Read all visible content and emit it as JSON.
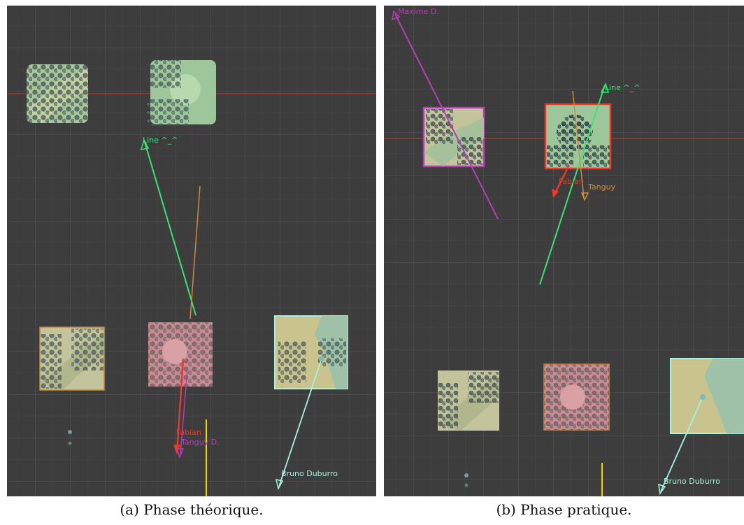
{
  "panel_a": {
    "caption": "(a) Phase théorique.",
    "labels": {
      "line": "Line ^_^",
      "fabian": "Fabian",
      "tanguy": "Tanguy D.",
      "bruno": "Bruno Duburro"
    }
  },
  "panel_b": {
    "caption": "(b) Phase pratique.",
    "labels": {
      "top_left": "Maxime D.",
      "line": "Line ^_^",
      "fabian": "Fabian",
      "tanguy": "Tanguy",
      "bruno": "Bruno Duburro"
    }
  },
  "colors": {
    "background": "#3d3d3d",
    "grid": "#575757",
    "horizon": "#c0392b",
    "line": "#3ae374",
    "fabian": "#e8392b",
    "tanguy": "#d4893a",
    "maxime": "#b53fb5",
    "bruno": "#a8f0e0",
    "yellow": "#f5d300",
    "terrain_green": "#a9c9a0",
    "terrain_pink": "#c98b92",
    "terrain_yellow": "#c9c48e"
  }
}
